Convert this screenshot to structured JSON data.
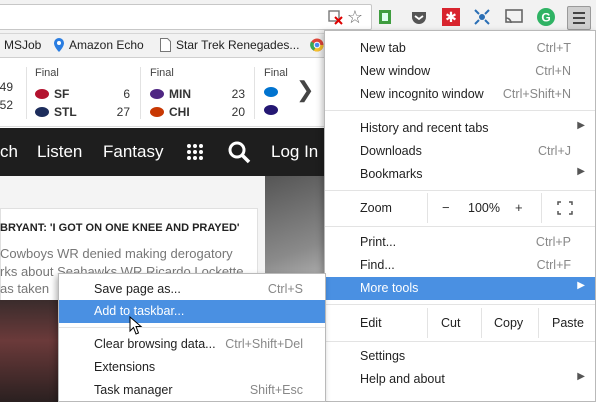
{
  "toolbar": {
    "icons": [
      "blocked-flash-icon",
      "star-icon",
      "extension-green-icon",
      "pocket-icon",
      "extension-red-icon",
      "satellite-icon",
      "cast-icon",
      "grammarly-icon",
      "chrome-menu-icon"
    ]
  },
  "bookmarks": {
    "items": [
      {
        "label": "MSJob"
      },
      {
        "label": "Amazon Echo"
      },
      {
        "label": "Star Trek Renegades..."
      }
    ]
  },
  "scores": {
    "games": [
      {
        "status": "",
        "team1": "",
        "score1": "49",
        "team2": "",
        "score2": "52"
      },
      {
        "status": "Final",
        "team1": "SF",
        "score1": "6",
        "team2": "STL",
        "score2": "27"
      },
      {
        "status": "Final",
        "team1": "MIN",
        "score1": "23",
        "team2": "CHI",
        "score2": "20"
      },
      {
        "status": "Final",
        "team1": "",
        "score1": "",
        "team2": "",
        "score2": ""
      }
    ]
  },
  "sitenav": {
    "items": [
      "ch",
      "Listen",
      "Fantasy",
      "Log In"
    ]
  },
  "article": {
    "headline": "BRYANT: 'I GOT ON ONE KNEE AND PRAYED'",
    "lines": [
      "Cowboys WR denied making derogatory",
      "rks about Seahawks WR Ricardo Lockette",
      "as taken"
    ]
  },
  "main_menu": {
    "new_tab": {
      "label": "New tab",
      "shortcut": "Ctrl+T"
    },
    "new_window": {
      "label": "New window",
      "shortcut": "Ctrl+N"
    },
    "new_incognito": {
      "label": "New incognito window",
      "shortcut": "Ctrl+Shift+N"
    },
    "history": {
      "label": "History and recent tabs"
    },
    "downloads": {
      "label": "Downloads",
      "shortcut": "Ctrl+J"
    },
    "bookmarks": {
      "label": "Bookmarks"
    },
    "zoom": {
      "label": "Zoom",
      "minus": "−",
      "value": "100%",
      "plus": "+"
    },
    "print": {
      "label": "Print...",
      "shortcut": "Ctrl+P"
    },
    "find": {
      "label": "Find...",
      "shortcut": "Ctrl+F"
    },
    "more_tools": {
      "label": "More tools"
    },
    "edit": {
      "label": "Edit",
      "cut": "Cut",
      "copy": "Copy",
      "paste": "Paste"
    },
    "settings": {
      "label": "Settings"
    },
    "help": {
      "label": "Help and about"
    }
  },
  "more_tools_menu": {
    "save_page": {
      "label": "Save page as...",
      "shortcut": "Ctrl+S"
    },
    "add_taskbar": {
      "label": "Add to taskbar..."
    },
    "clear_data": {
      "label": "Clear browsing data...",
      "shortcut": "Ctrl+Shift+Del"
    },
    "extensions": {
      "label": "Extensions"
    },
    "task_manager": {
      "label": "Task manager",
      "shortcut": "Shift+Esc"
    }
  },
  "colors": {
    "highlight": "#4a90e2",
    "nav_bg": "#1e1e1e"
  }
}
